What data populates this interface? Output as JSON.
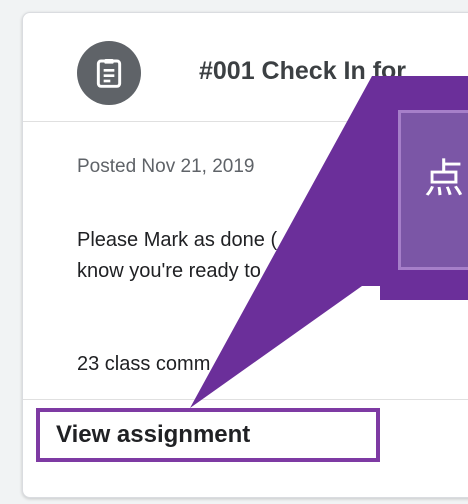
{
  "assignment": {
    "icon": "assignment-clipboard-icon",
    "title": "#001 Check In for",
    "posted": "Posted Nov 21, 2019",
    "description_line1": "Please Mark as done (",
    "description_line2": "know you're ready to g",
    "comments": "23 class comm",
    "view_label": "View assignment"
  },
  "callout": {
    "text": "点",
    "fill_color": "#6b2f9a",
    "box_color": "#7b56a6"
  },
  "colors": {
    "accent": "#7e3aa3",
    "icon_bg": "#5f6368"
  }
}
